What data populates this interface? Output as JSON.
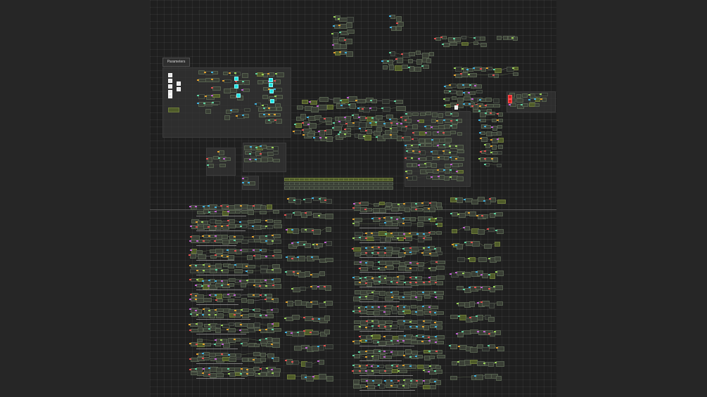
{
  "editor": {
    "background_color": "#262626",
    "canvas_color": "#1f1f1f",
    "group_label": "Parameters"
  },
  "node_colors": {
    "default": "#3a3f36",
    "highlight_cyan": "#1fe0e0",
    "error_red": "#dd2222",
    "note_white": "#e8e8e8"
  },
  "icons": [
    "node-graph-canvas"
  ]
}
